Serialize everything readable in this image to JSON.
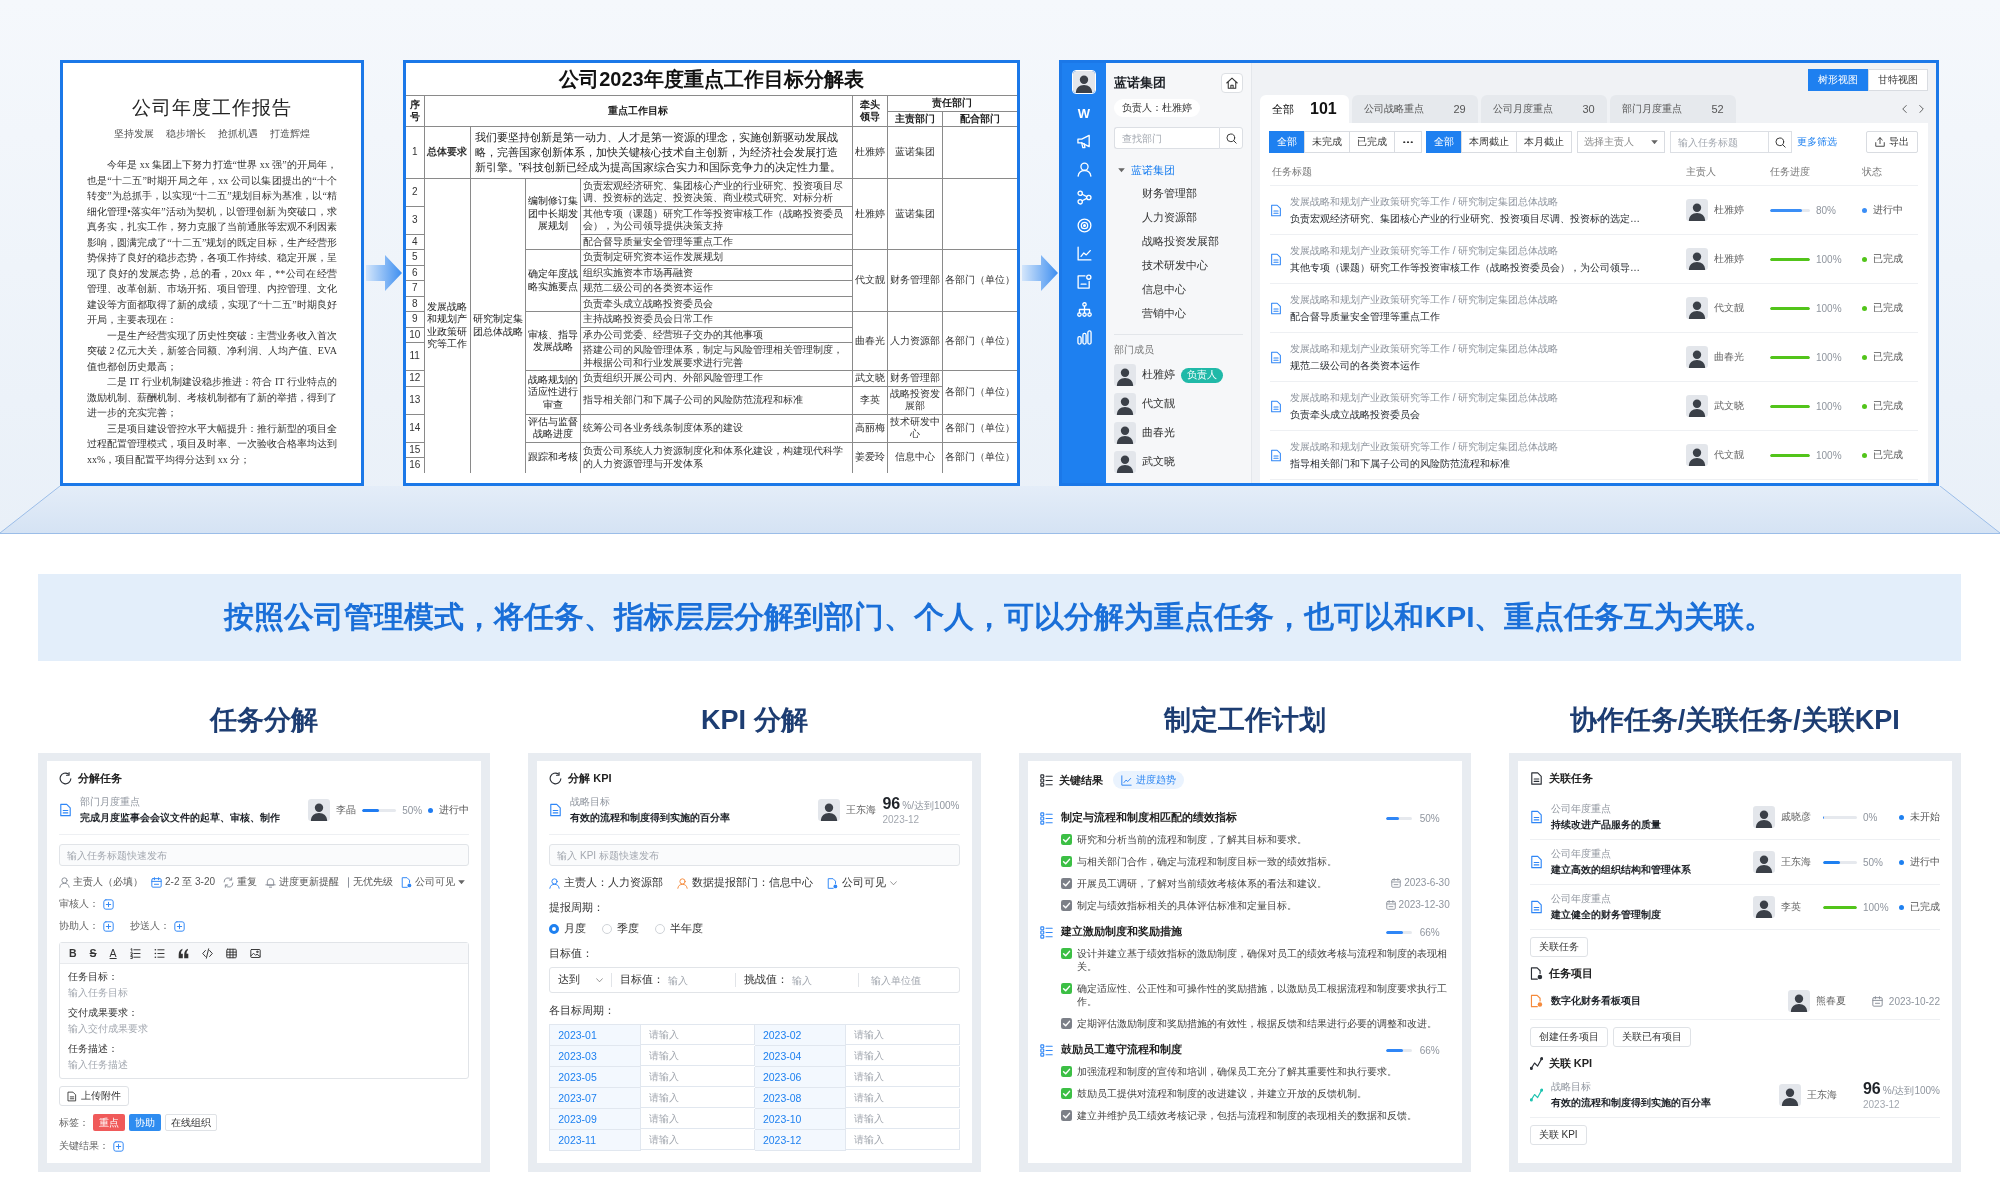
{
  "report_doc": {
    "title": "公司年度工作报告",
    "subtitle": [
      "坚持发展",
      "稳步增长",
      "抢抓机遇",
      "打造辉煌"
    ],
    "paragraphs": [
      "今年是 xx 集团上下努力打造“世界 xx 强”的开局年，也是“十二五”时期开局之年，xx 公司以集团提出的“十个转变”为总抓手，以实现“十二五”规划目标为基准，以“精细化管理•落实年”活动为契机，以管理创新为突破口，求真务实，扎实工作，努力克服了当前通胀等宏观不利因素影响，圆满完成了“十二五”规划的既定目标，生产经营形势保持了良好的稳步态势，各项工作持续、稳定开展，呈现了良好的发展态势，总的看，20xx 年，**公司在经营管理、改革创新、市场开拓、项目管理、内控管理、文化建设等方面都取得了新的成绩，实现了“十二五”时期良好开局，主要表现在：",
      "一是生产经营实现了历史性突破：主营业务收入首次突破 2 亿元大关，新签合同额、净利润、人均产值、EVA 值也都创历史最高；",
      "二是 IT 行业机制建设稳步推进：符合 IT 行业特点的激励机制、薪酬机制、考核机制都有了新的举措，得到了进一步的充实完善；",
      "三是项目建设管控水平大幅提升：推行新型的项目全过程配置管理模式，项目及时率、一次验收合格率均达到 xx%，项目配置平均得分达到 xx 分；"
    ]
  },
  "goal_table": {
    "title": "公司2023年度重点工作目标分解表",
    "headers": {
      "seq": "序号",
      "goal": "重点工作目标",
      "leader": "牵头领导",
      "responsible": "责任部门",
      "main_dept": "主责部门",
      "coop_dept": "配合部门"
    },
    "general": {
      "seq": "1",
      "label": "总体要求",
      "text": "我们要坚持创新是第一动力、人才是第一资源的理念，实施创新驱动发展战略，完善国家创新体系，加快关键核心技术自主创新，为经济社会发展打造新引擎。”科技创新已经成为提高国家综合实力和国际竞争力的决定性力量。",
      "leader": "杜雅婷",
      "main_dept": "蓝诺集团"
    },
    "area": {
      "label": "发展战略和规划产业政策研究等工作",
      "task": "研究制定集团总体战略",
      "groups": [
        {
          "name": "编制修订集团中长期发展规划",
          "assignments": [
            {
              "leader": "杜雅婷",
              "main_dept": "蓝诺集团",
              "items": [
                {
                  "seq": [
                    "2"
                  ],
                  "text": "负责宏观经济研究、集团核心产业的行业研究、投资项目尽调、投资标的选定、投资决策、商业模式研究、对标分析"
                },
                {
                  "seq": [
                    "3"
                  ],
                  "text": "其他专项（课题）研究工作等投资审核工作（战略投资委员会），为公司领导提供决策支持"
                },
                {
                  "seq": [
                    "4"
                  ],
                  "text": "配合督导质量安全管理等重点工作"
                }
              ]
            }
          ]
        },
        {
          "name": "确定年度战略实施要点",
          "coop_dept": "各部门（单位）",
          "assignments": [
            {
              "leader": "代文靓",
              "main_dept": "财务管理部",
              "items": [
                {
                  "seq": [
                    "5"
                  ],
                  "text": "负责制定研究资本运作发展规划"
                },
                {
                  "seq": [
                    "6"
                  ],
                  "text": "组织实施资本市场再融资"
                },
                {
                  "seq": [
                    "7"
                  ],
                  "text": "规范二级公司的各类资本运作"
                },
                {
                  "seq": [
                    "8"
                  ],
                  "text": "负责牵头成立战略投资委员会"
                }
              ]
            }
          ]
        },
        {
          "name": "审核、指导发展战略",
          "coop_dept": "各部门（单位）",
          "assignments": [
            {
              "leader": "曲春光",
              "main_dept": "人力资源部",
              "items": [
                {
                  "seq": [
                    "9"
                  ],
                  "text": "主持战略投资委员会日常工作"
                },
                {
                  "seq": [
                    "10"
                  ],
                  "text": "承办公司党委、经营班子交办的其他事项"
                },
                {
                  "seq": [
                    "11"
                  ],
                  "text": "搭建公司的风险管理体系，制定与风险管理相关管理制度，并根据公司和行业发展要求进行完善"
                }
              ]
            }
          ]
        },
        {
          "name": "战略规划的适应性进行审查",
          "coop_dept": "各部门（单位）",
          "assignments": [
            {
              "leader": "武文晓",
              "main_dept": "财务管理部",
              "items": [
                {
                  "seq": [
                    "12"
                  ],
                  "text": "负责组织开展公司内、外部风险管理工作"
                }
              ]
            },
            {
              "leader": "李英",
              "main_dept": "战略投资发展部",
              "items": [
                {
                  "seq": [
                    "13"
                  ],
                  "text": "指导相关部门和下属子公司的风险防范流程和标准"
                }
              ]
            }
          ]
        },
        {
          "name": "评估与监督战略进度",
          "coop_dept": "各部门（单位）",
          "assignments": [
            {
              "leader": "高丽梅",
              "main_dept": "技术研发中心",
              "items": [
                {
                  "seq": [
                    "14"
                  ],
                  "text": "统筹公司各业务线条制度体系的建设"
                }
              ]
            }
          ]
        },
        {
          "name": "跟踪和考核",
          "coop_dept": "各部门（单位）",
          "assignments": [
            {
              "leader": "姜爱玲",
              "main_dept": "信息中心",
              "items": [
                {
                  "seq": [
                    "15",
                    "16"
                  ],
                  "text": "负责公司系统人力资源制度化和体系化建设，构建现代科学的人力资源管理与开发体系"
                }
              ]
            }
          ]
        }
      ]
    }
  },
  "task_app": {
    "logo": "W",
    "org": {
      "name": "蓝诺集团",
      "owner": "负责人：杜雅婷",
      "search": {
        "placeholder": "查找部门"
      },
      "tree": [
        {
          "label": "蓝诺集团",
          "expanded": true,
          "selected": true,
          "children": [
            {
              "label": "财务管理部",
              "selected": false
            },
            {
              "label": "人力资源部",
              "selected": false
            },
            {
              "label": "战略投资发展部",
              "selected": false
            },
            {
              "label": "技术研发中心",
              "selected": false
            },
            {
              "label": "信息中心",
              "selected": false
            },
            {
              "label": "营销中心",
              "selected": false
            }
          ]
        }
      ],
      "members_label": "部门成员",
      "members": [
        {
          "name": "杜雅婷",
          "badge": "负责人"
        },
        {
          "name": "代文靓"
        },
        {
          "name": "曲春光"
        },
        {
          "name": "武文晓"
        }
      ]
    },
    "views": [
      {
        "label": "树形视图",
        "selected": true
      },
      {
        "label": "甘特视图",
        "selected": false
      }
    ],
    "tabs": [
      {
        "label": "全部",
        "count": "101",
        "selected": true
      },
      {
        "label": "公司战略重点",
        "count": "29",
        "selected": false
      },
      {
        "label": "公司月度重点",
        "count": "30",
        "selected": false
      },
      {
        "label": "部门月度重点",
        "count": "52",
        "selected": false
      }
    ],
    "status_filters": [
      {
        "label": "全部",
        "selected": true
      },
      {
        "label": "未完成",
        "selected": false
      },
      {
        "label": "已完成",
        "selected": false
      }
    ],
    "due_filters": [
      {
        "label": "全部",
        "selected": true
      },
      {
        "label": "本周截止",
        "selected": false
      },
      {
        "label": "本月截止",
        "selected": false
      }
    ],
    "owner_select": {
      "placeholder": "选择主责人"
    },
    "title_search": {
      "placeholder": "输入任务标题"
    },
    "more_filters": "更多筛选",
    "export_button": "导出",
    "columns": [
      "任务标题",
      "主责人",
      "任务进度",
      "状态"
    ],
    "rows": [
      {
        "path": "发展战略和规划产业政策研究等工作 / 研究制定集团总体战略",
        "title": "负责宏观经济研究、集团核心产业的行业研究、投资项目尽调、投资标的选定…",
        "owner": "杜雅婷",
        "level": 0.8,
        "progress": "80%",
        "status": "进行中",
        "color": "#3a8ef6"
      },
      {
        "path": "发展战略和规划产业政策研究等工作 / 研究制定集团总体战略",
        "title": "其他专项（课题）研究工作等投资审核工作（战略投资委员会），为公司领导…",
        "owner": "杜雅婷",
        "level": 1,
        "progress": "100%",
        "status": "已完成",
        "color": "#52c41a"
      },
      {
        "path": "发展战略和规划产业政策研究等工作 / 研究制定集团总体战略",
        "title": "配合督导质量安全管理等重点工作",
        "owner": "代文靓",
        "level": 1,
        "progress": "100%",
        "status": "已完成",
        "color": "#52c41a"
      },
      {
        "path": "发展战略和规划产业政策研究等工作 / 研究制定集团总体战略",
        "title": "规范二级公司的各类资本运作",
        "owner": "曲春光",
        "level": 1,
        "progress": "100%",
        "status": "已完成",
        "color": "#52c41a"
      },
      {
        "path": "发展战略和规划产业政策研究等工作 / 研究制定集团总体战略",
        "title": "负责牵头成立战略投资委员会",
        "owner": "武文晓",
        "level": 1,
        "progress": "100%",
        "status": "已完成",
        "color": "#52c41a"
      },
      {
        "path": "发展战略和规划产业政策研究等工作 / 研究制定集团总体战略",
        "title": "指导相关部门和下属子公司的风险防范流程和标准",
        "owner": "代文靓",
        "level": 1,
        "progress": "100%",
        "status": "已完成",
        "color": "#52c41a"
      }
    ]
  },
  "banner": "按照公司管理模式，将任务、指标层层分解到部门、个人，可以分解为重点任务，也可以和KPI、重点任务互为关联。",
  "sections": [
    {
      "kind": "task_breakdown",
      "title": "任务分解",
      "panel_title": "分解任务",
      "task": {
        "category": "部门月度重点",
        "title": "完成月度监事会会议文件的起草、审核、制作",
        "owner": "李晶",
        "level": 0.5,
        "progress": "50%",
        "status": "进行中",
        "color": "#1f7cf2"
      },
      "quick_input": {
        "placeholder": "输入任务标题快速发布"
      },
      "options": [
        {
          "kind": "owner",
          "label": "主责人（必填）"
        },
        {
          "kind": "date",
          "label": "2-2 至 3-20"
        },
        {
          "kind": "repeat",
          "label": "重复"
        },
        {
          "kind": "reminder",
          "label": "进度更新提醒"
        },
        {
          "kind": "priority",
          "label": "无优先级"
        },
        {
          "kind": "visibility",
          "label": "公司可见"
        }
      ],
      "people": [
        [
          "审核人："
        ],
        [
          "协助人：",
          "抄送人："
        ]
      ],
      "toolbar": [
        {
          "kind": "bold",
          "glyph": "B"
        },
        {
          "kind": "strike",
          "glyph": "S"
        },
        {
          "kind": "color",
          "glyph": "A"
        },
        {
          "kind": "numbers"
        },
        {
          "kind": "bullets"
        },
        {
          "kind": "quote"
        },
        {
          "kind": "code"
        },
        {
          "kind": "table"
        },
        {
          "kind": "image"
        }
      ],
      "fields": [
        {
          "label": "任务目标：",
          "placeholder": "输入任务目标"
        },
        {
          "label": "交付成果要求：",
          "placeholder": "输入交付成果要求"
        },
        {
          "label": "任务描述：",
          "placeholder": "输入任务描述"
        }
      ],
      "upload_button": "上传附件",
      "tags_label": "标签：",
      "tags": [
        {
          "label": "重点",
          "color": "#f05a5a"
        },
        {
          "label": "协助",
          "color": "#2e8cf0"
        },
        {
          "label": "在线组织"
        }
      ],
      "key_results_label": "关键结果："
    },
    {
      "kind": "kpi_breakdown",
      "title": "KPI 分解",
      "panel_title": "分解 KPI",
      "kpi": {
        "category": "战略目标",
        "title": "有效的流程和制度得到实施的百分率",
        "owner": "王东海",
        "value": "96",
        "target": "%/达到100%",
        "period": "2023-12"
      },
      "quick_input": {
        "placeholder": "输入 KPI 标题快速发布"
      },
      "meta": [
        {
          "kind": "owner",
          "label": "主责人：人力资源部"
        },
        {
          "kind": "reporter",
          "label": "数据提报部门：信息中心"
        },
        {
          "kind": "visibility",
          "label": "公司可见"
        }
      ],
      "cycle_label": "提报周期：",
      "cycles": [
        {
          "label": "月度",
          "selected": true
        },
        {
          "label": "季度",
          "selected": false
        },
        {
          "label": "半年度",
          "selected": false
        }
      ],
      "target_label": "目标值：",
      "target": {
        "mode": "达到",
        "goal_label": "目标值：",
        "goal_placeholder": "输入",
        "challenge_label": "挑战值：",
        "challenge_placeholder": "输入",
        "unit_placeholder": "输入单位值"
      },
      "periods_label": "各目标周期：",
      "periods": [
        {
          "month": "2023-01",
          "placeholder": "请输入"
        },
        {
          "month": "2023-02",
          "placeholder": "请输入"
        },
        {
          "month": "2023-03",
          "placeholder": "请输入"
        },
        {
          "month": "2023-04",
          "placeholder": "请输入"
        },
        {
          "month": "2023-05",
          "placeholder": "请输入"
        },
        {
          "month": "2023-06",
          "placeholder": "请输入"
        },
        {
          "month": "2023-07",
          "placeholder": "请输入"
        },
        {
          "month": "2023-08",
          "placeholder": "请输入"
        },
        {
          "month": "2023-09",
          "placeholder": "请输入"
        },
        {
          "month": "2023-10",
          "placeholder": "请输入"
        },
        {
          "month": "2023-11",
          "placeholder": "请输入"
        },
        {
          "month": "2023-12",
          "placeholder": "请输入"
        }
      ]
    },
    {
      "kind": "work_plan",
      "title": "制定工作计划",
      "panel_title": "关键结果",
      "trend_button": "进度趋势",
      "objectives": [
        {
          "title": "制定与流程和制度相匹配的绩效指标",
          "level": 0.5,
          "progress": "50%",
          "steps": [
            {
              "text": "研究和分析当前的流程和制度，了解其目标和要求。",
              "done": true
            },
            {
              "text": "与相关部门合作，确定与流程和制度目标一致的绩效指标。",
              "done": true
            },
            {
              "text": "开展员工调研，了解对当前绩效考核体系的看法和建议。",
              "done": false,
              "date": "2023-6-30"
            },
            {
              "text": "制定与绩效指标相关的具体评估标准和定量目标。",
              "done": false,
              "date": "2023-12-30"
            }
          ]
        },
        {
          "title": "建立激励制度和奖励措施",
          "level": 0.66,
          "progress": "66%",
          "steps": [
            {
              "text": "设计并建立基于绩效指标的激励制度，确保对员工的绩效考核与流程和制度的表现相关。",
              "done": true
            },
            {
              "text": "确定适应性、公正性和可操作性的奖励措施，以激励员工根据流程和制度要求执行工作。",
              "done": true
            },
            {
              "text": "定期评估激励制度和奖励措施的有效性，根据反馈和结果进行必要的调整和改进。",
              "done": false
            }
          ]
        },
        {
          "title": "鼓励员工遵守流程和制度",
          "level": 0.66,
          "progress": "66%",
          "steps": [
            {
              "text": "加强流程和制度的宣传和培训，确保员工充分了解其重要性和执行要求。",
              "done": true
            },
            {
              "text": "鼓励员工提供对流程和制度的改进建议，并建立开放的反馈机制。",
              "done": true
            },
            {
              "text": "建立并维护员工绩效考核记录，包括与流程和制度的表现相关的数据和反馈。",
              "done": false
            }
          ]
        }
      ]
    },
    {
      "kind": "collaboration",
      "title": "协作任务/关联任务/关联KPI",
      "task_heading": "关联任务",
      "tasks": [
        {
          "category": "公司年度重点",
          "title": "持续改进产品服务的质量",
          "owner": "戚晓彦",
          "level": 0,
          "progress": "0%",
          "status": "未开始"
        },
        {
          "category": "公司年度重点",
          "title": "建立高效的组织结构和管理体系",
          "owner": "王东海",
          "level": 0.5,
          "progress": "50%",
          "status": "进行中",
          "color": "#1e80f0"
        },
        {
          "category": "公司年度重点",
          "title": "建立健全的财务管理制度",
          "owner": "李英",
          "level": 1,
          "progress": "100%",
          "status": "已完成",
          "color": "#52c41a"
        }
      ],
      "task_button": "关联任务",
      "project_heading": "任务项目",
      "projects": [
        {
          "title": "数字化财务看板项目",
          "owner": "熊春夏",
          "date": "2023-10-22"
        }
      ],
      "project_buttons": [
        "创建任务项目",
        "关联已有项目"
      ],
      "kpi_heading": "关联 KPI",
      "kpis": [
        {
          "category": "战略目标",
          "title": "有效的流程和制度得到实施的百分率",
          "owner": "王东海",
          "value": "96",
          "target": "%/达到100%",
          "period": "2023-12"
        }
      ],
      "kpi_button": "关联 KPI"
    }
  ]
}
